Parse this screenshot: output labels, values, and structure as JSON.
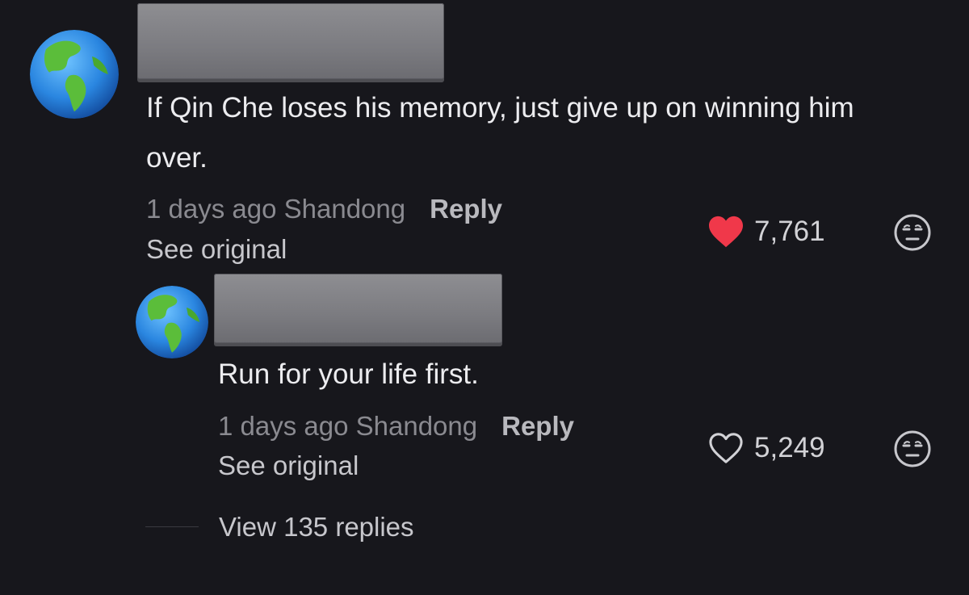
{
  "comments": [
    {
      "avatar_icon": "globe-icon",
      "username_redacted": true,
      "text": "If Qin Che loses his memory, just give up on winning him over.",
      "meta": "1 days ago Shandong",
      "reply_label": "Reply",
      "see_original_label": "See original",
      "like_count": "7,761",
      "liked": true,
      "like_color": "#f0384a"
    },
    {
      "avatar_icon": "globe-icon",
      "username_redacted": true,
      "text": "Run for your life first.",
      "meta": "1 days ago Shandong",
      "reply_label": "Reply",
      "see_original_label": "See original",
      "like_count": "5,249",
      "liked": false
    }
  ],
  "view_replies_label": "View 135 replies"
}
